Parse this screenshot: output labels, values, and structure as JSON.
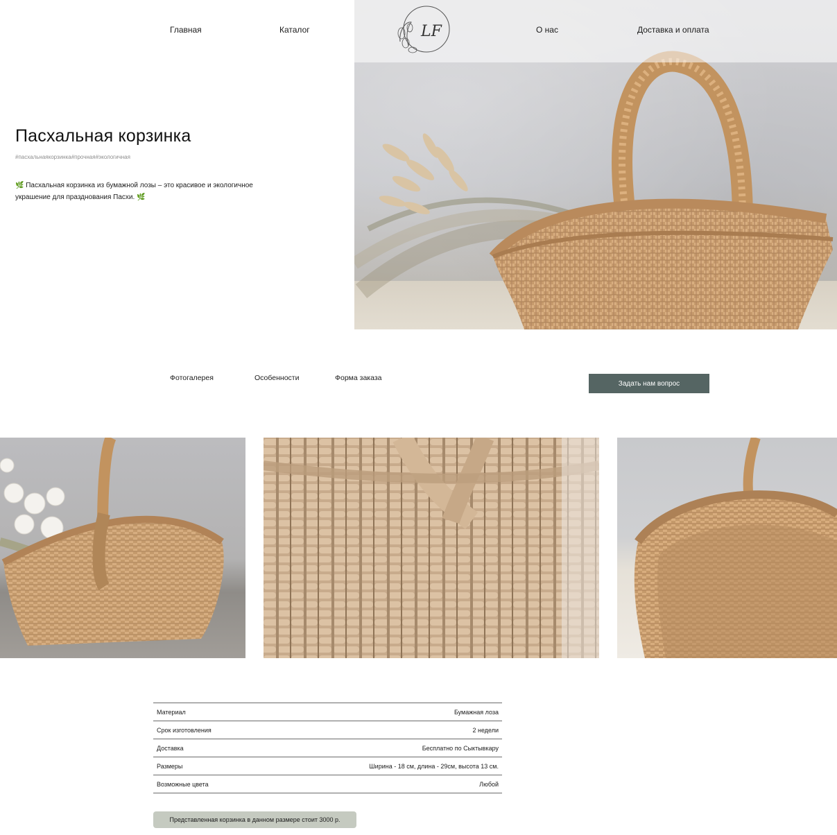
{
  "header": {
    "nav_left": [
      "Главная",
      "Каталог"
    ],
    "nav_right": [
      "О нас",
      "Доставка и оплата"
    ],
    "logo_text": "LF"
  },
  "product": {
    "title": "Пасхальная корзинка",
    "tags": "#пасхальнаякорзинка#прочная#экологичная",
    "description_line1": "Пасхальная корзинка из бумажной лозы – это красивое и экологичное",
    "description_line2": "украшение для празднования Пасхи.",
    "leaf_icon": "🌿"
  },
  "subnav": {
    "links": [
      "Фотогалерея",
      "Особенности",
      "Форма заказа"
    ],
    "ask_button": "Задать нам вопрос"
  },
  "specs": [
    {
      "label": "Материал",
      "value": "Бумажная лоза"
    },
    {
      "label": "Срок изготовления",
      "value": "2 недели"
    },
    {
      "label": "Доставка",
      "value": "Бесплатно по Сыктывкару"
    },
    {
      "label": "Размеры",
      "value": "Ширина - 18 см, длина - 29см, высота 13 см."
    },
    {
      "label": "Возможные цвета",
      "value": "Любой"
    }
  ],
  "price_note": "Представленная корзинка в данном размере стоит 3000 р.",
  "colors": {
    "button": "#556563",
    "price_badge": "#c5cac0",
    "wicker": "#c49a6c"
  }
}
